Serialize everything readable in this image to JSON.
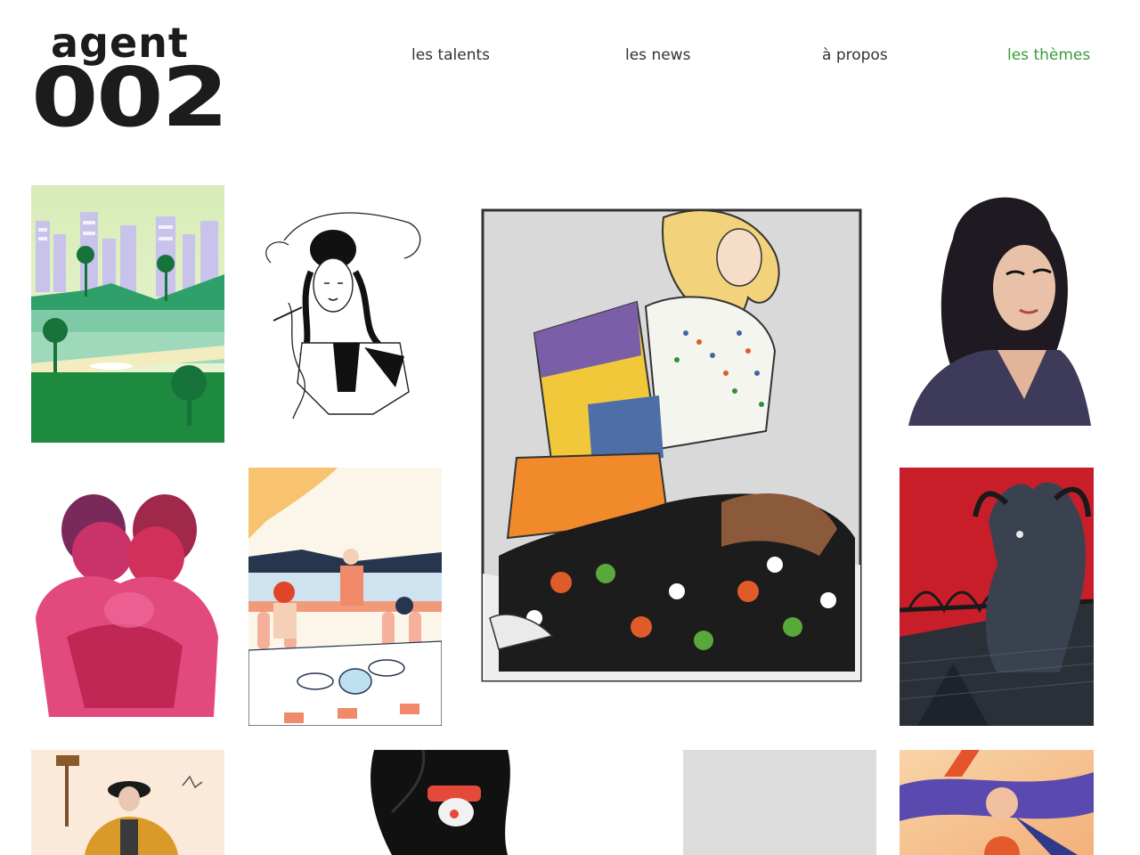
{
  "logo": {
    "line1": "agent",
    "line2": "002"
  },
  "nav": {
    "talents": "les talents",
    "news": "les news",
    "about": "à propos",
    "themes": "les thèmes"
  },
  "colors": {
    "accent": "#3a9a3a",
    "text": "#333333",
    "background": "#ffffff"
  },
  "gallery": [
    {
      "name": "city-palms-illustration"
    },
    {
      "name": "smoking-woman-line-drawing"
    },
    {
      "name": "blonde-woman-sweater-illustration"
    },
    {
      "name": "woman-portrait-watercolor"
    },
    {
      "name": "kissing-couple-watercolor"
    },
    {
      "name": "terrace-dinner-illustration"
    },
    {
      "name": "goat-bridge-engraving"
    },
    {
      "name": "croquet-woman-illustration"
    },
    {
      "name": "black-ink-figure-illustration"
    },
    {
      "name": "grey-placeholder-tile"
    },
    {
      "name": "abstract-figure-gradient-illustration"
    }
  ]
}
